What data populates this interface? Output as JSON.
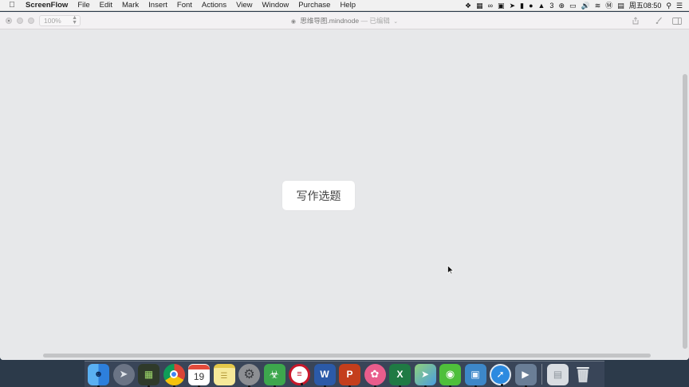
{
  "menubar": {
    "app_name": "ScreenFlow",
    "items": [
      "File",
      "Edit",
      "Mark",
      "Insert",
      "Font",
      "Actions",
      "View",
      "Window",
      "Purchase",
      "Help"
    ],
    "status_count": "3",
    "clock": "周五08:50"
  },
  "window": {
    "zoom_level": "100%",
    "doc_name": "思维导图.mindnode",
    "doc_status": "— 已编辑"
  },
  "canvas": {
    "central_node_label": "写作选题"
  },
  "dock": {
    "calendar_day": "19",
    "icons": [
      {
        "name": "finder-icon",
        "color": "#3b8ee6"
      },
      {
        "name": "launchpad-icon",
        "color": "#6b7485"
      },
      {
        "name": "mission-control-icon",
        "color": "#2f3a2a"
      },
      {
        "name": "chrome-icon",
        "color": "#e9e9e9"
      },
      {
        "name": "calendar-icon",
        "color": "#ffffff"
      },
      {
        "name": "notes-icon",
        "color": "#f6e99a"
      },
      {
        "name": "system-preferences-icon",
        "color": "#8d8f93"
      },
      {
        "name": "evernote-icon",
        "color": "#3da74d"
      },
      {
        "name": "bank-icon",
        "color": "#c8182b"
      },
      {
        "name": "word-icon",
        "color": "#2b5aa8"
      },
      {
        "name": "powerpoint-icon",
        "color": "#c43e1c"
      },
      {
        "name": "brain-app-icon",
        "color": "#e95d8c"
      },
      {
        "name": "excel-icon",
        "color": "#1f7a44"
      },
      {
        "name": "maps-icon",
        "color": "#6bb36a"
      },
      {
        "name": "wechat-icon",
        "color": "#4fbf3b"
      },
      {
        "name": "preview-icon",
        "color": "#3d87c8"
      },
      {
        "name": "safari-icon",
        "color": "#2b8ae0"
      },
      {
        "name": "screenflow-icon",
        "color": "#6a7e96"
      }
    ]
  }
}
